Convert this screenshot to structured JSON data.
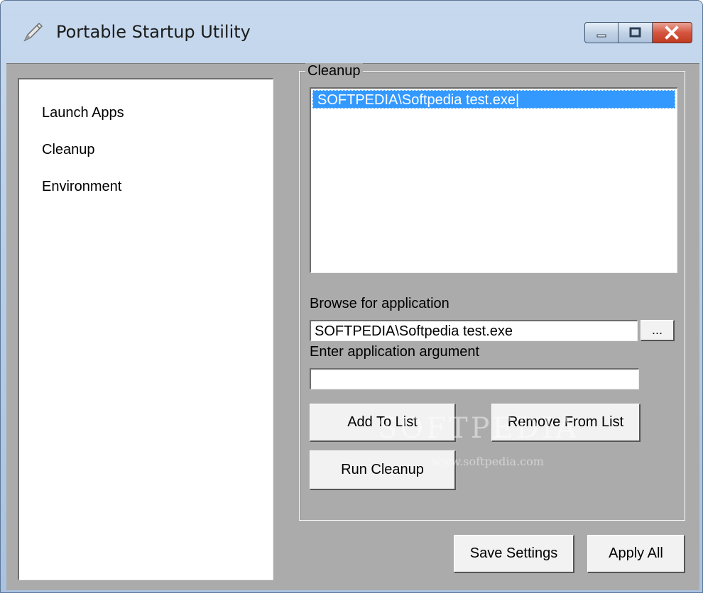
{
  "window": {
    "title": "Portable Startup Utility",
    "icon": "pen-icon"
  },
  "caption_buttons": {
    "minimize_icon": "minimize-icon",
    "maximize_icon": "maximize-icon",
    "close_icon": "close-icon"
  },
  "nav": {
    "items": [
      {
        "label": "Launch Apps"
      },
      {
        "label": "Cleanup"
      },
      {
        "label": "Environment"
      }
    ]
  },
  "cleanup": {
    "group_title": "Cleanup",
    "list_items": [
      {
        "text": "SOFTPEDIA\\Softpedia test.exe|"
      }
    ],
    "browse_label": "Browse for application",
    "browse_value": "SOFTPEDIA\\Softpedia test.exe",
    "browse_button_label": "...",
    "argument_label": "Enter application argument",
    "argument_value": "",
    "add_button_label": "Add To List",
    "remove_button_label": "Remove From List",
    "run_button_label": "Run Cleanup"
  },
  "footer": {
    "save_button_label": "Save Settings",
    "apply_button_label": "Apply All"
  },
  "watermark": {
    "brand": "SOFTPEDIA",
    "url": "www.softpedia.com"
  },
  "colors": {
    "selection": "#3399ff",
    "client_background": "#ababab",
    "close_button": "#c03c22"
  }
}
